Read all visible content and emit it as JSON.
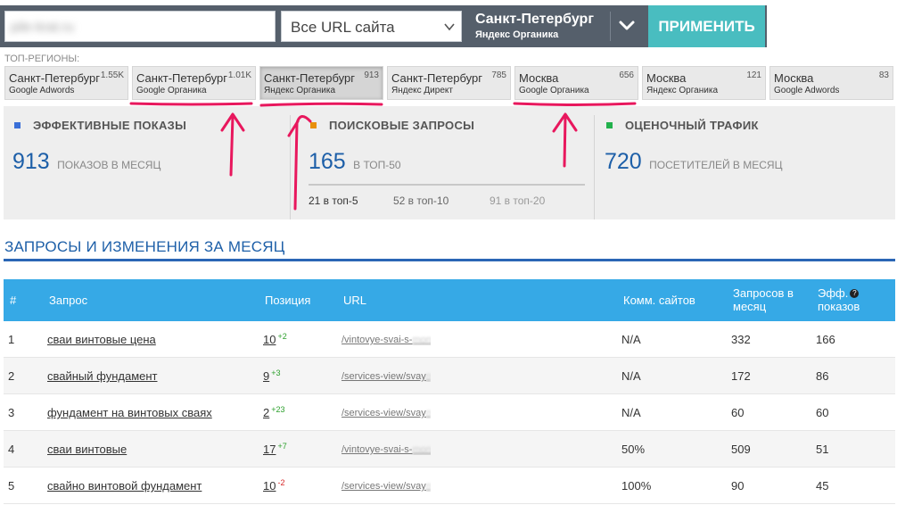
{
  "controls": {
    "domain_placeholder": "pile-krat.ru",
    "url_scope": "Все URL сайта",
    "region_city": "Санкт-Петербург",
    "region_source": "Яндекс Органика",
    "apply_label": "ПРИМЕНИТЬ"
  },
  "top_regions": {
    "label": "ТОП-РЕГИОНЫ:",
    "items": [
      {
        "city": "Санкт-Петербург",
        "source": "Google Adwords",
        "count": "1.55K"
      },
      {
        "city": "Санкт-Петербург",
        "source": "Google Органика",
        "count": "1.01K"
      },
      {
        "city": "Санкт-Петербург",
        "source": "Яндекс Органика",
        "count": "913"
      },
      {
        "city": "Санкт-Петербург",
        "source": "Яндекс Директ",
        "count": "785"
      },
      {
        "city": "Москва",
        "source": "Google Органика",
        "count": "656"
      },
      {
        "city": "Москва",
        "source": "Яндекс Органика",
        "count": "121"
      },
      {
        "city": "Москва",
        "source": "Google Adwords",
        "count": "83"
      }
    ]
  },
  "stats": {
    "impressions": {
      "title": "ЭФФЕКТИВНЫЕ ПОКАЗЫ",
      "value": "913",
      "unit": "ПОКАЗОВ В МЕСЯЦ",
      "color": "#3a6fd8"
    },
    "queries": {
      "title": "ПОИСКОВЫЕ ЗАПРОСЫ",
      "value": "165",
      "unit": "В ТОП-50",
      "color": "#e8900c",
      "top5": "21 в топ-5",
      "top10": "52 в топ-10",
      "top20": "91 в топ-20"
    },
    "traffic": {
      "title": "ОЦЕНОЧНЫЙ ТРАФИК",
      "value": "720",
      "unit": "ПОСЕТИТЕЛЕЙ В МЕСЯЦ",
      "color": "#22b14c"
    }
  },
  "section_title": "ЗАПРОСЫ И ИЗМЕНЕНИЯ ЗА МЕСЯЦ",
  "table": {
    "headers": {
      "num": "#",
      "query": "Запрос",
      "position": "Позиция",
      "url": "URL",
      "competition": "Комм. сайтов",
      "volume_1": "Запросов в",
      "volume_2": "месяц",
      "eff_1": "Эфф.",
      "eff_2": "показов"
    },
    "rows": [
      {
        "n": "1",
        "query": "сваи винтовые цена",
        "pos": "10",
        "delta": "+2",
        "url_shown": "/vintovye-svai-s-",
        "url_faded": "mont",
        "comp": "N/A",
        "volume": "332",
        "eff": "166"
      },
      {
        "n": "2",
        "query": "свайный фундамент",
        "pos": "9",
        "delta": "+3",
        "url_shown": "/services-view/svay",
        "url_faded": "ny",
        "comp": "N/A",
        "volume": "172",
        "eff": "86"
      },
      {
        "n": "3",
        "query": "фундамент на винтовых сваях",
        "pos": "2",
        "delta": "+23",
        "url_shown": "/services-view/svay",
        "url_faded": "ny",
        "comp": "N/A",
        "volume": "60",
        "eff": "60"
      },
      {
        "n": "4",
        "query": "сваи винтовые",
        "pos": "17",
        "delta": "+7",
        "url_shown": "/vintovye-svai-s-",
        "url_faded": "mont",
        "comp": "50%",
        "volume": "509",
        "eff": "51"
      },
      {
        "n": "5",
        "query": "свайно винтовой фундамент",
        "pos": "10",
        "delta": "-2",
        "url_shown": "/services-view/svay",
        "url_faded": "ny",
        "comp": "100%",
        "volume": "90",
        "eff": "45"
      }
    ]
  },
  "colors": {
    "bar_bg": "#555f6b",
    "apply_bg": "#49bdc0",
    "table_header": "#36a9e6",
    "accent_blue": "#1d5fa8",
    "annotation_red": "#e8175d",
    "delta_up": "#2ca02c",
    "delta_down": "#d62728"
  }
}
